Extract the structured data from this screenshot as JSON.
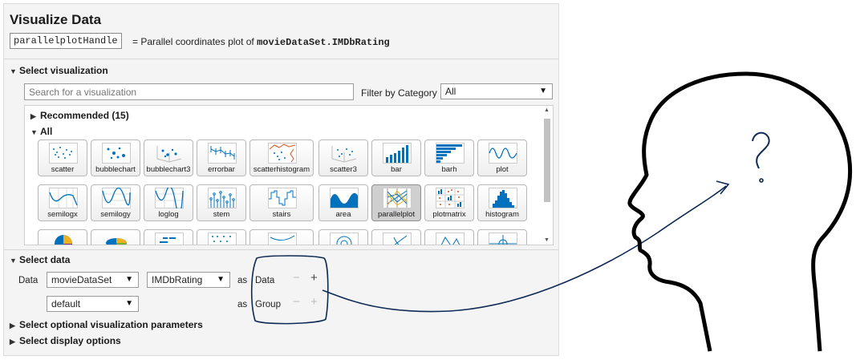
{
  "panel": {
    "title": "Visualize Data",
    "handle_value": "parallelplotHandle",
    "handle_description_prefix": "= Parallel coordinates plot of",
    "handle_description_code": "movieDataSet.IMDbRating"
  },
  "select_visualization": {
    "header": "Select visualization",
    "search_placeholder": "Search for a visualization",
    "filter_label": "Filter by Category",
    "filter_value": "All",
    "recommended_label": "Recommended (15)",
    "all_label": "All",
    "tiles": [
      {
        "label": "scatter",
        "icon": "scatter-icon"
      },
      {
        "label": "bubblechart",
        "icon": "bubblechart-icon"
      },
      {
        "label": "bubblechart3",
        "icon": "bubblechart3-icon"
      },
      {
        "label": "errorbar",
        "icon": "errorbar-icon"
      },
      {
        "label": "scatterhistogram",
        "icon": "scatterhistogram-icon"
      },
      {
        "label": "scatter3",
        "icon": "scatter3-icon"
      },
      {
        "label": "bar",
        "icon": "bar-icon"
      },
      {
        "label": "barh",
        "icon": "barh-icon"
      },
      {
        "label": "plot",
        "icon": "plot-icon"
      },
      {
        "label": "semilogx",
        "icon": "semilogx-icon"
      },
      {
        "label": "semilogy",
        "icon": "semilogy-icon"
      },
      {
        "label": "loglog",
        "icon": "loglog-icon"
      },
      {
        "label": "stem",
        "icon": "stem-icon"
      },
      {
        "label": "stairs",
        "icon": "stairs-icon"
      },
      {
        "label": "area",
        "icon": "area-icon"
      },
      {
        "label": "parallelplot",
        "icon": "parallelplot-icon",
        "selected": true
      },
      {
        "label": "plotmatrix",
        "icon": "plotmatrix-icon"
      },
      {
        "label": "histogram",
        "icon": "histogram-icon"
      },
      {
        "label": "",
        "icon": "pie-icon"
      },
      {
        "label": "",
        "icon": "pie3-icon"
      },
      {
        "label": "",
        "icon": "heatmap-icon"
      },
      {
        "label": "",
        "icon": "spy-icon"
      },
      {
        "label": "",
        "icon": "contour-icon"
      },
      {
        "label": "",
        "icon": "polar-icon"
      },
      {
        "label": "",
        "icon": "compass-icon"
      },
      {
        "label": "",
        "icon": "geo-icon"
      },
      {
        "label": "",
        "icon": "waterfall-icon"
      }
    ]
  },
  "select_data": {
    "header": "Select data",
    "data_label": "Data",
    "row1": {
      "source": "movieDataSet",
      "field": "IMDbRating",
      "as": "as",
      "role": "Data"
    },
    "row2": {
      "source": "default",
      "as": "as",
      "role": "Group"
    },
    "minus": "−",
    "plus": "+"
  },
  "optional_params_header": "Select optional visualization parameters",
  "display_options_header": "Select display options",
  "colors": {
    "panel_bg": "#f4f4f4",
    "accent_blue": "#0072bd",
    "orange": "#d95319",
    "ink": "#0d2a55"
  }
}
